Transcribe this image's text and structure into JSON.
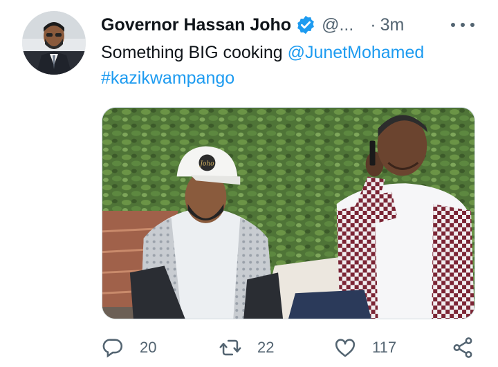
{
  "tweet": {
    "author_name": "Governor Hassan Joho",
    "handle": "@...",
    "separator": "·",
    "time": "3m",
    "text_main": "Something BIG cooking ",
    "mention": "@JunetMohamed",
    "hashtag": "#kazikwampango",
    "cap_text": "Joho"
  },
  "actions": {
    "replies": "20",
    "retweets": "22",
    "likes": "117"
  },
  "icons": {
    "verified": "verified-badge-icon",
    "more": "more-icon",
    "reply": "reply-icon",
    "retweet": "retweet-icon",
    "like": "like-icon",
    "share": "share-icon"
  },
  "colors": {
    "link": "#1d9bf0",
    "verified": "#1d9bf0",
    "secondary_text": "#536471"
  }
}
